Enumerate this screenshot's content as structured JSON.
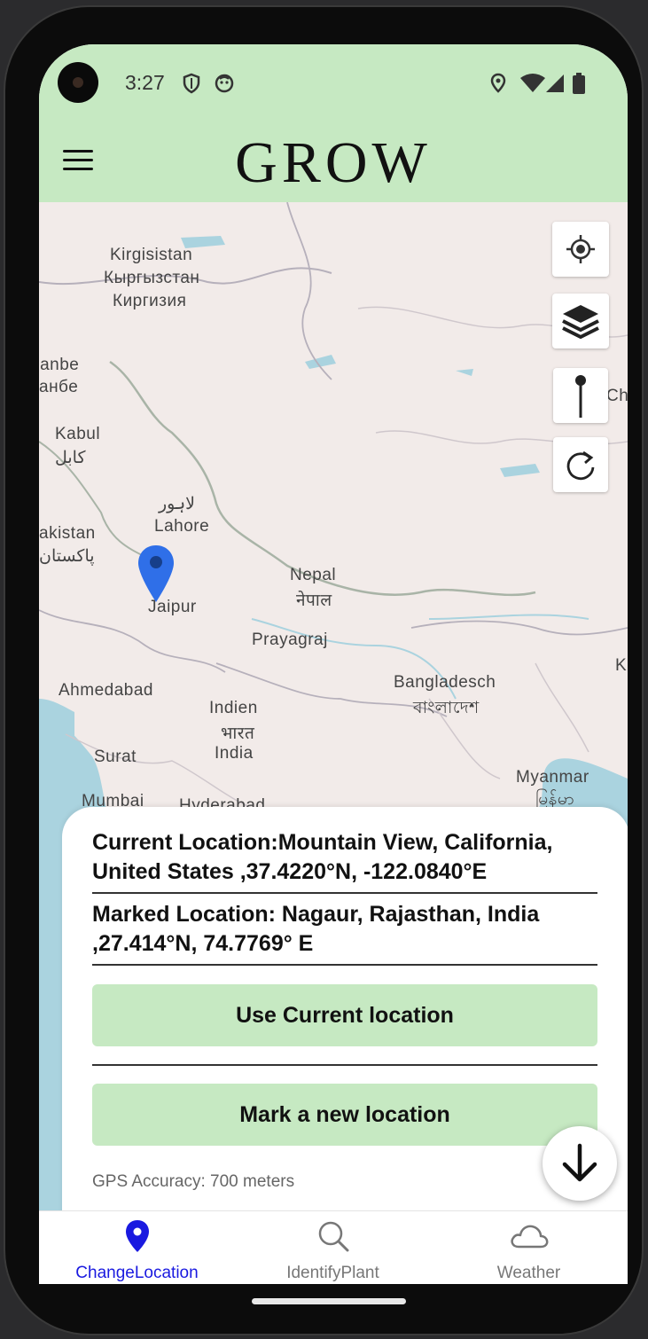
{
  "status_bar": {
    "time": "3:27"
  },
  "app_bar": {
    "title": "GROW"
  },
  "map": {
    "labels": {
      "kyrgyzstan_1": "Kirgisistan",
      "kyrgyzstan_2": "Кыргызстан",
      "kyrgyzstan_3": "Киргизия",
      "anbe_1": "nanbe",
      "anbe_2": "анбе",
      "kabul_1": "Kabul",
      "kabul_2": "کابل",
      "lahore_1": "لاہور",
      "lahore_2": "Lahore",
      "pakistan_1": "akistan",
      "pakistan_2": "پاکستان",
      "nepal_1": "Nepal",
      "nepal_2": "नेपाल",
      "jaipur": "Jaipur",
      "prayagraj": "Prayagraj",
      "ahmedabad": "Ahmedabad",
      "bangladesh_1": "Bangladesch",
      "bangladesh_2": "বাংলাদেশ",
      "india_1": "Indien",
      "india_2": "भारत",
      "india_3": "India",
      "surat": "Surat",
      "myanmar_1": "Myanmar",
      "myanmar_2": "မြန်မာ",
      "mumbai": "Mumbai",
      "hyderabad": "Hyderabad",
      "china_edge": "Ch",
      "k_edge": "K"
    },
    "controls": [
      "my-location",
      "layers",
      "drop-pin",
      "refresh"
    ]
  },
  "sheet": {
    "current_location": "Current Location:Mountain View, California, United States ,37.4220°N, -122.0840°E",
    "marked_location": "Marked Location: Nagaur, Rajasthan, India ,27.414°N, 74.7769° E",
    "use_current_button": "Use Current location",
    "mark_new_button": "Mark a new location",
    "gps_accuracy": "GPS Accuracy: 700 meters"
  },
  "bottom_nav": {
    "items": [
      {
        "label": "ChangeLocation",
        "icon": "location-pin-icon",
        "active": true
      },
      {
        "label": "IdentifyPlant",
        "icon": "search-icon",
        "active": false
      },
      {
        "label": "Weather",
        "icon": "cloud-icon",
        "active": false
      }
    ]
  },
  "colors": {
    "app_bar": "#c6e9c2",
    "button": "#c6e9c2",
    "active_nav": "#1a1ae0",
    "pin": "#2f6fe8"
  }
}
